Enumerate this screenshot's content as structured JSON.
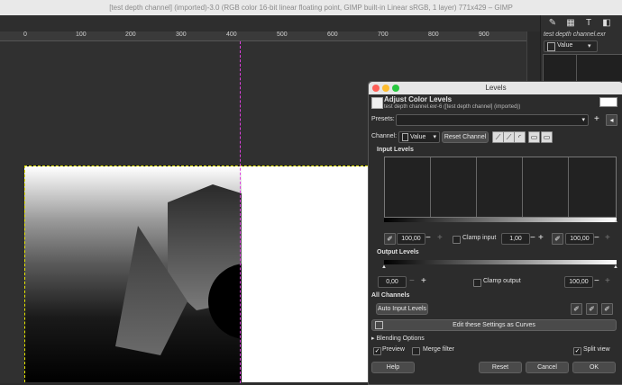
{
  "window": {
    "title": "[test depth channel] (imported)-3.0 (RGB color 16-bit linear floating point, GIMP built-in Linear sRGB, 1 layer) 771x429 – GIMP"
  },
  "ruler": {
    "ticks": [
      "0",
      "100",
      "200",
      "300",
      "400",
      "500",
      "600",
      "700",
      "800",
      "900"
    ]
  },
  "dock": {
    "image_title": "test depth channel.exr",
    "mode_value": "Value"
  },
  "dialog": {
    "title": "Levels",
    "header_title": "Adjust Color Levels",
    "header_subtitle": "test depth channel.exr-6 ([test depth channel] (imported))",
    "presets_label": "Presets:",
    "presets_value": "",
    "channel_label": "Channel:",
    "channel_value": "Value",
    "reset_channel_label": "Reset Channel",
    "input_levels_label": "Input Levels",
    "input_low": "100,00",
    "clamp_input_label": "Clamp input",
    "input_gamma": "1,00",
    "input_high": "100,00",
    "output_levels_label": "Output Levels",
    "output_low": "0,00",
    "clamp_output_label": "Clamp output",
    "output_high": "100,00",
    "all_channels_label": "All Channels",
    "auto_input_label": "Auto Input Levels",
    "curves_label": "Edit these Settings as Curves",
    "blending_label": "Blending Options",
    "preview_label": "Preview",
    "preview_checked": true,
    "merge_filter_label": "Merge filter",
    "merge_checked": false,
    "split_view_label": "Split view",
    "split_checked": true,
    "help_label": "Help",
    "reset_label": "Reset",
    "cancel_label": "Cancel",
    "ok_label": "OK"
  }
}
